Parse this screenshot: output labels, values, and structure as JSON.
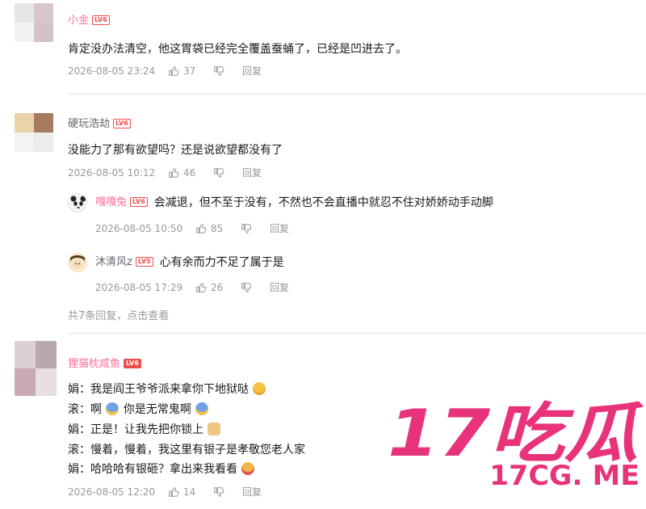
{
  "comments": [
    {
      "username": "小金",
      "level": "LV6",
      "text": "肯定没办法清空，他这胃袋已经完全覆盖蚕蛹了，已经是凹进去了。",
      "time": "2026-08-05 23:24",
      "likes": "37",
      "reply_label": "回复"
    },
    {
      "username": "硬玩浩劫",
      "level": "LV6",
      "text": "没能力了那有欲望吗？还是说欲望都没有了",
      "time": "2026-08-05 10:12",
      "likes": "46",
      "reply_label": "回复",
      "replies": [
        {
          "username": "嘎嘎兔",
          "level": "LV6",
          "text": "会减退，但不至于没有，不然也不会直播中就忍不住对娇娇动手动脚",
          "time": "2026-08-05 10:50",
          "likes": "85",
          "reply_label": "回复"
        },
        {
          "username": "沐清风z",
          "level": "LV5",
          "text": "心有余而力不足了属于是",
          "time": "2026-08-05 17:29",
          "likes": "26",
          "reply_label": "回复"
        }
      ],
      "more_replies": "共7条回复，点击查看"
    },
    {
      "username": "狸猫枕咸鱼",
      "level": "LV6",
      "lines": [
        {
          "speaker": "娟：",
          "text": "我是阎王爷爷派来拿你下地狱哒"
        },
        {
          "speaker": "滚：",
          "text": "啊",
          "text2": "你是无常鬼啊"
        },
        {
          "speaker": "娟：",
          "text": "正是！让我先把你锁上"
        },
        {
          "speaker": "滚：",
          "text": "慢着，慢着，我这里有银子是孝敬您老人家"
        },
        {
          "speaker": "娟：",
          "text": "哈哈哈有银砸？拿出来我看看"
        }
      ],
      "time": "2026-08-05 12:20",
      "likes": "14",
      "reply_label": "回复"
    }
  ],
  "watermark": {
    "big": "17吃瓜",
    "small": "17CG. ME"
  },
  "colors": {
    "username": "#fb7299",
    "username_alt": "#61666d",
    "level": "#f04c49",
    "meta": "#9499a0",
    "watermark": "#e8337a"
  }
}
